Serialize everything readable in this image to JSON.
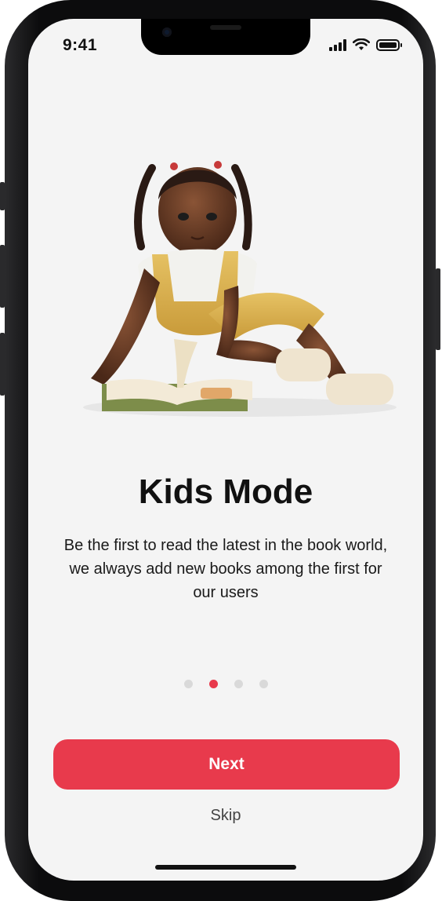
{
  "status_bar": {
    "time": "9:41",
    "icons": [
      "cellular-signal-icon",
      "wifi-icon",
      "battery-icon"
    ]
  },
  "illustration": {
    "name": "girl-reading-book-illustration"
  },
  "onboarding": {
    "title": "Kids Mode",
    "description": "Be the first to read the latest in the book world, we always add new books among the first for our users",
    "pagination": {
      "total": 4,
      "current": 2
    }
  },
  "actions": {
    "next_label": "Next",
    "skip_label": "Skip"
  },
  "colors": {
    "accent": "#e83a4c",
    "background": "#f4f4f4",
    "dot_inactive": "#d9d9d9"
  }
}
